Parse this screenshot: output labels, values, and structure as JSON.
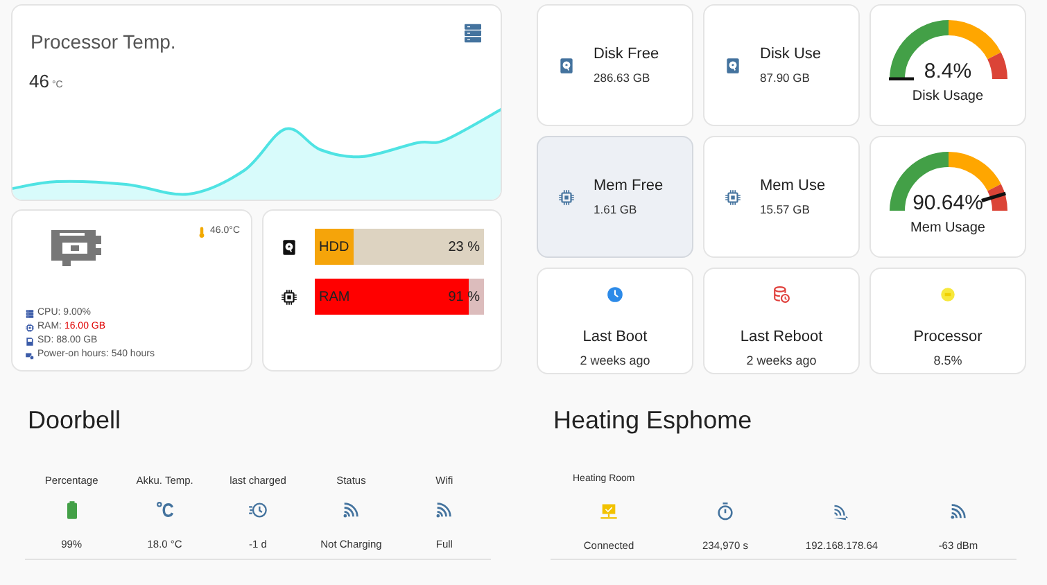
{
  "processor_temp": {
    "title": "Processor Temp.",
    "value": "46",
    "unit": "°C"
  },
  "system_card": {
    "temperature": "46.0°C",
    "stats": [
      {
        "label": "CPU:",
        "value": "9.00%",
        "alert": false
      },
      {
        "label": "RAM:",
        "value": "16.00 GB",
        "alert": true
      },
      {
        "label": "SD:",
        "value": "88.00 GB",
        "alert": false
      },
      {
        "label": "Power-on hours:",
        "value": "540 hours",
        "alert": false
      }
    ]
  },
  "bars": [
    {
      "label": "HDD",
      "value": "23 %",
      "level": 0.23,
      "color": "#f5a40a"
    },
    {
      "label": "RAM",
      "value": "91 %",
      "level": 0.91,
      "color": "#ff0000"
    }
  ],
  "tiles": [
    {
      "kind": "entity",
      "name": "Disk Free",
      "value": "286.63 GB",
      "hovered": false
    },
    {
      "kind": "entity",
      "name": "Disk Use",
      "value": "87.90 GB",
      "hovered": false
    },
    {
      "kind": "gauge",
      "name": "Disk Usage",
      "value": "8.4%"
    },
    {
      "kind": "entity",
      "name": "Mem Free",
      "value": "1.61 GB",
      "hovered": true
    },
    {
      "kind": "entity",
      "name": "Mem Use",
      "value": "15.57 GB",
      "hovered": false
    },
    {
      "kind": "gauge",
      "name": "Mem Usage",
      "value": "90.64%"
    },
    {
      "kind": "button",
      "name": "Last Boot",
      "value": "2 weeks ago"
    },
    {
      "kind": "button",
      "name": "Last Reboot",
      "value": "2 weeks ago"
    },
    {
      "kind": "button",
      "name": "Processor",
      "value": "8.5%"
    }
  ],
  "doorbell": {
    "title": "Doorbell",
    "columns": [
      {
        "label": "Percentage",
        "value": "99%"
      },
      {
        "label": "Akku. Temp.",
        "value": "18.0 °C"
      },
      {
        "label": "last charged",
        "value": "-1 d"
      },
      {
        "label": "Status",
        "value": "Not Charging"
      },
      {
        "label": "Wifi",
        "value": "Full"
      }
    ]
  },
  "heating": {
    "title": "Heating Esphome",
    "subtitle": "Heating Room",
    "columns": [
      {
        "value": "Connected"
      },
      {
        "value": "234,970 s"
      },
      {
        "value": "192.168.178.64"
      },
      {
        "value": "-63 dBm"
      }
    ]
  }
}
